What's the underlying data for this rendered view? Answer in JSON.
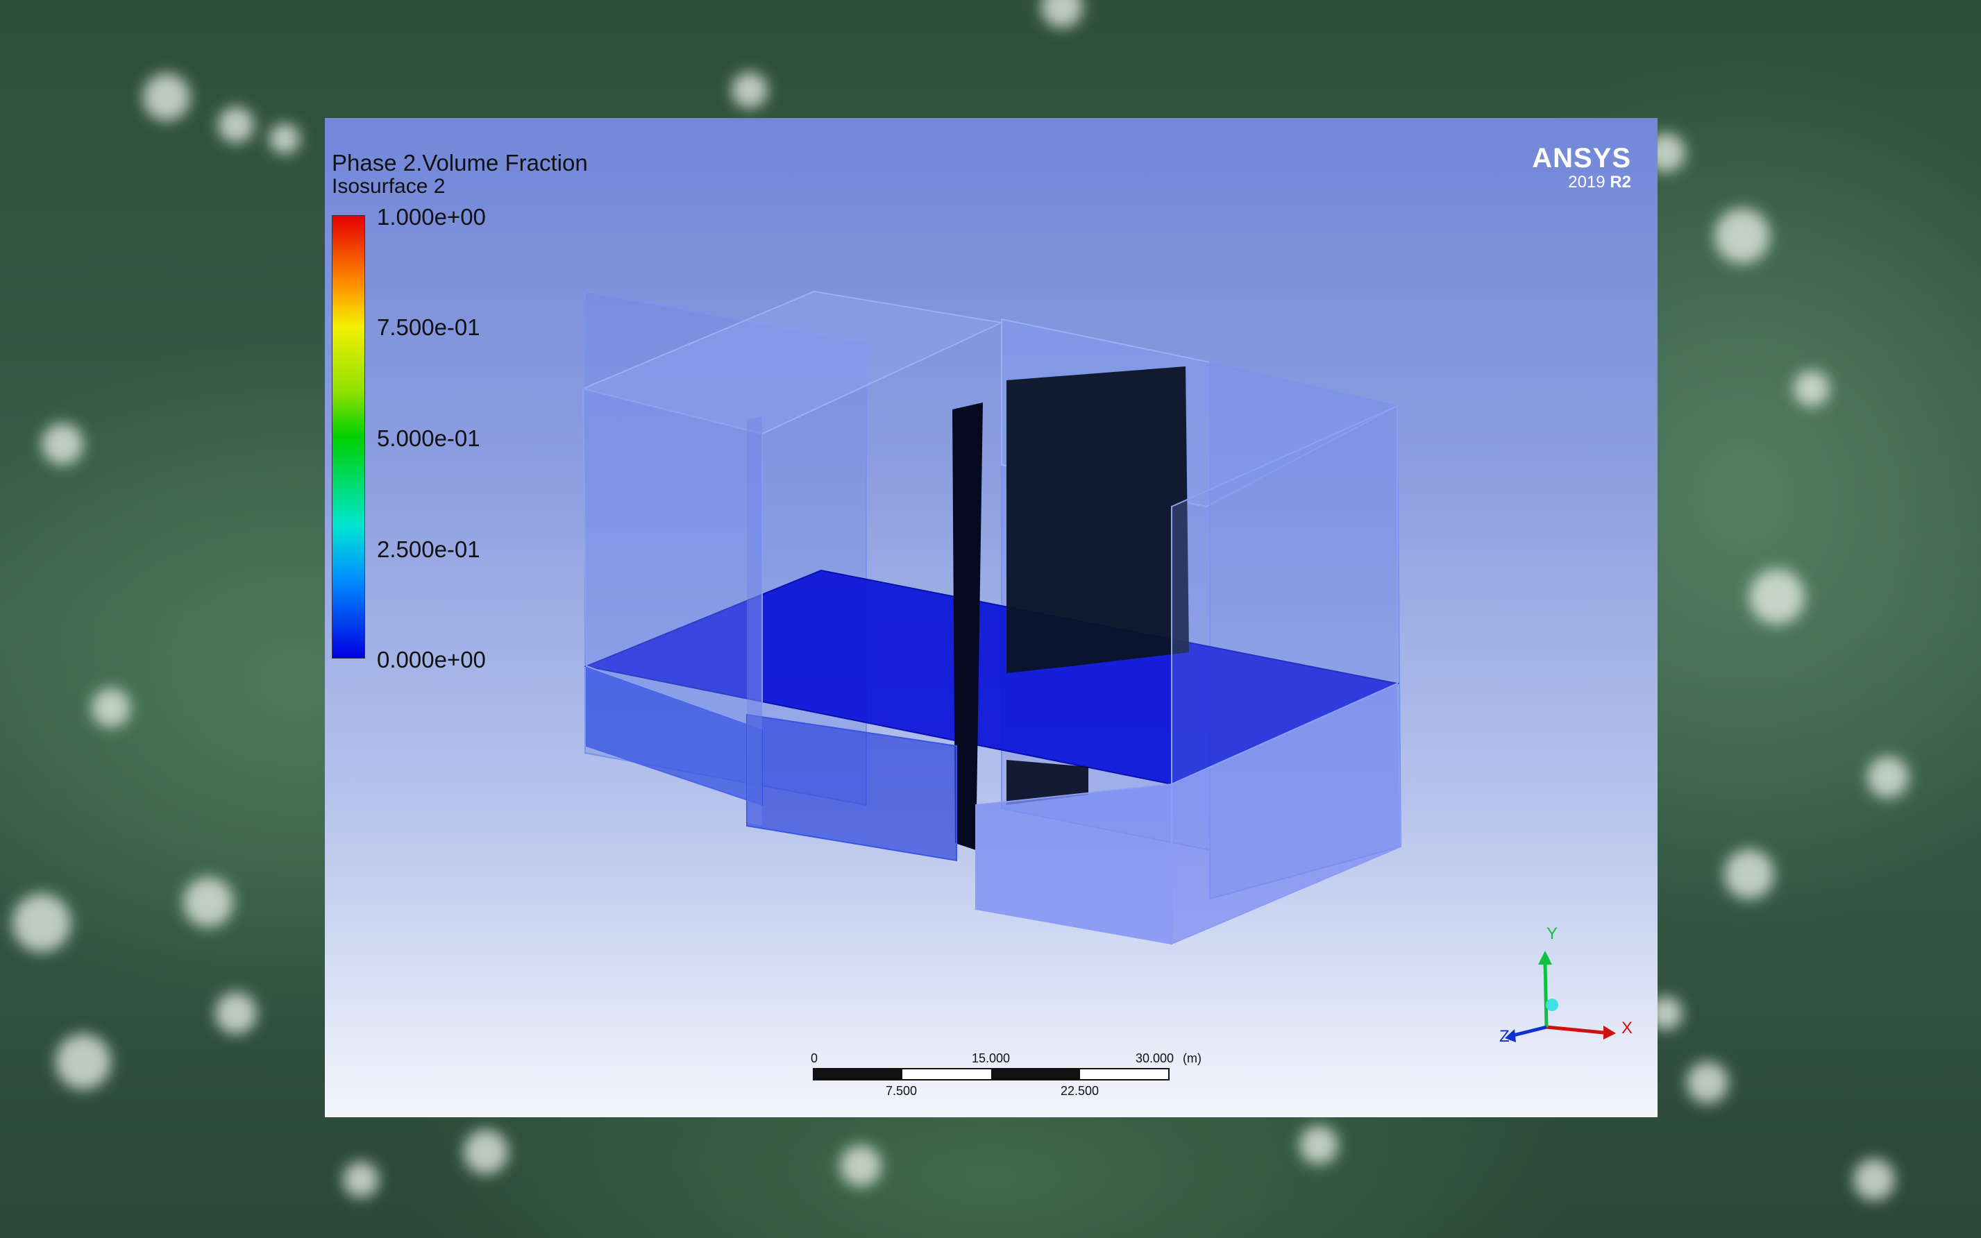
{
  "legend": {
    "title": "Phase 2.Volume Fraction",
    "subtitle": "Isosurface 2",
    "ticks": [
      "1.000e+00",
      "7.500e-01",
      "5.000e-01",
      "2.500e-01",
      "0.000e+00"
    ],
    "colormap": [
      "#e40000",
      "#ff8a00",
      "#f4f000",
      "#00d000",
      "#00e6d0",
      "#0000e0"
    ]
  },
  "brand": {
    "name": "ANSYS",
    "year": "2019",
    "release": "R2"
  },
  "scalebar": {
    "top_labels": [
      "0",
      "15.000",
      "30.000"
    ],
    "unit": "(m)",
    "bottom_labels": [
      "7.500",
      "22.500"
    ]
  },
  "triad": {
    "x_label": "X",
    "y_label": "Y",
    "z_label": "Z",
    "x_color": "#d01010",
    "y_color": "#10c040",
    "z_color": "#1030d0"
  },
  "scene": {
    "domain_color": "#6f86e6",
    "isosurface_color": "#0a14d8",
    "obstacle_color": "#050a20"
  }
}
